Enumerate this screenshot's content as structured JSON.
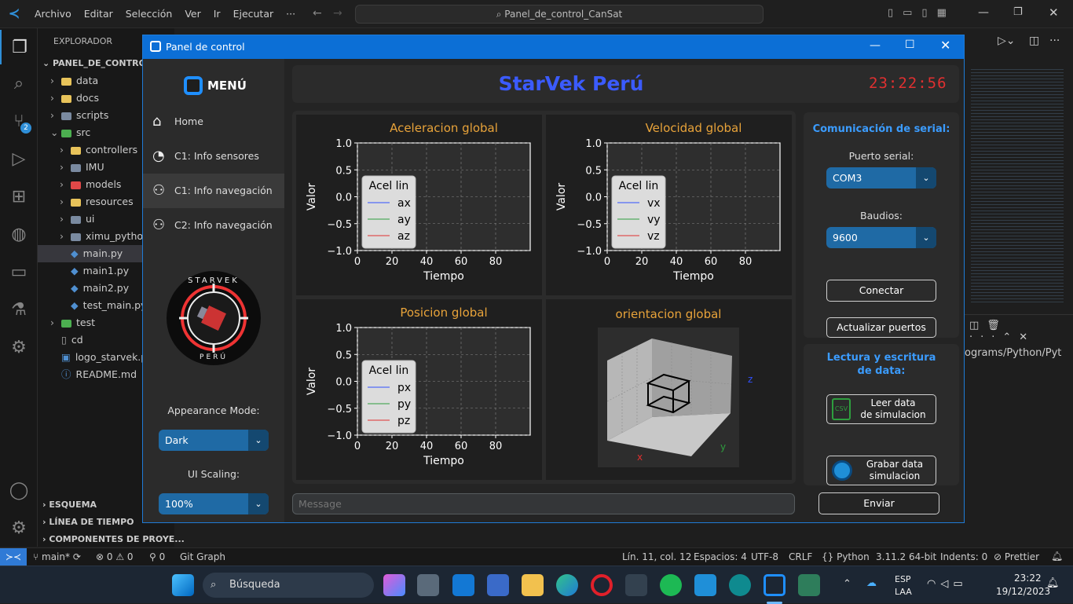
{
  "vscode": {
    "menu": [
      "Archivo",
      "Editar",
      "Selección",
      "Ver",
      "Ir",
      "Ejecutar",
      "···"
    ],
    "search_text": "Panel_de_control_CanSat",
    "explorer_title": "EXPLORADOR",
    "project_title": "PANEL_DE_CONTROL_...",
    "tree": [
      {
        "label": "data",
        "kind": "folder",
        "color": "#e8c35a",
        "indent": 1
      },
      {
        "label": "docs",
        "kind": "folder",
        "color": "#e8c35a",
        "indent": 1
      },
      {
        "label": "scripts",
        "kind": "folder",
        "color": "#7a8aa0",
        "indent": 1
      },
      {
        "label": "src",
        "kind": "folder-open",
        "color": "#4caf50",
        "indent": 1
      },
      {
        "label": "controllers",
        "kind": "folder",
        "color": "#e8c35a",
        "indent": 2
      },
      {
        "label": "IMU",
        "kind": "folder",
        "color": "#7a8aa0",
        "indent": 2
      },
      {
        "label": "models",
        "kind": "folder",
        "color": "#e04848",
        "indent": 2
      },
      {
        "label": "resources",
        "kind": "folder",
        "color": "#e8c35a",
        "indent": 2
      },
      {
        "label": "ui",
        "kind": "folder",
        "color": "#7a8aa0",
        "indent": 2
      },
      {
        "label": "ximu_python...",
        "kind": "folder",
        "color": "#7a8aa0",
        "indent": 2
      },
      {
        "label": "main.py",
        "kind": "py",
        "indent": 2
      },
      {
        "label": "main1.py",
        "kind": "py",
        "indent": 2
      },
      {
        "label": "main2.py",
        "kind": "py",
        "indent": 2
      },
      {
        "label": "test_main.py",
        "kind": "py",
        "indent": 2
      },
      {
        "label": "test",
        "kind": "folder",
        "color": "#4caf50",
        "indent": 1
      },
      {
        "label": "cd",
        "kind": "file",
        "indent": 1
      },
      {
        "label": "logo_starvek.png",
        "kind": "img",
        "indent": 1
      },
      {
        "label": "README.md",
        "kind": "info",
        "indent": 1
      }
    ],
    "bottom_sections": [
      "ESQUEMA",
      "LÍNEA DE TIEMPO",
      "COMPONENTES DE PROYE..."
    ],
    "terminal_path": "ograms/Python/Pyt",
    "scm_badge": "2",
    "status_left": [
      "main*",
      "⊗ 0 ⚠ 0",
      "⚲ 0",
      "Git Graph"
    ],
    "status_right": [
      "Lín. 11, col. 12",
      "Espacios: 4",
      "UTF-8",
      "CRLF",
      "{} Python",
      "3.11.2 64-bit",
      "Indents: 0",
      "⊘ Prettier"
    ]
  },
  "taskbar": {
    "search": "Búsqueda",
    "lang": "ESP",
    "lang2": "LAA",
    "time": "23:22",
    "date": "19/12/2023"
  },
  "app": {
    "title": "Panel de control",
    "menu_title": "MENÚ",
    "nav": [
      {
        "label": "Home",
        "icon": "home-icon"
      },
      {
        "label": "C1: Info sensores",
        "icon": "chat-icon"
      },
      {
        "label": "C1: Info navegación",
        "icon": "user-gear-icon"
      },
      {
        "label": "C2: Info navegación",
        "icon": "user-gear-icon"
      }
    ],
    "logo_top": "STARVEK",
    "logo_bottom": "PERÚ",
    "appearance_label": "Appearance Mode:",
    "appearance_value": "Dark",
    "scaling_label": "UI Scaling:",
    "scaling_value": "100%",
    "header_title": "StarVek Perú",
    "clock": "23:22:56",
    "serial_title": "Comunicación de serial:",
    "port_label": "Puerto serial:",
    "port_value": "COM3",
    "baud_label": "Baudios:",
    "baud_value": "9600",
    "connect_label": "Conectar",
    "refresh_label": "Actualizar puertos",
    "rw_title_1": "Lectura y escritura",
    "rw_title_2": "de data:",
    "read_label_1": "Leer data",
    "read_label_2": "de simulacion",
    "record_label_1": "Grabar data",
    "record_label_2": "simulacion",
    "message_placeholder": "Message",
    "send_label": "Enviar",
    "orient_title": "orientacion global",
    "orient_axes": [
      "x",
      "y",
      "z"
    ]
  },
  "colors": {
    "accent": "#1f6aa5",
    "title_blue": "#3b5bff",
    "clock_red": "#e03030",
    "plot_title": "#e8a33a",
    "serial_title": "#3b9cff"
  },
  "chart_data": [
    {
      "type": "line",
      "title": "Aceleracion global",
      "xlabel": "Tiempo",
      "ylabel": "Valor",
      "xlim": [
        0,
        100
      ],
      "ylim": [
        -1,
        1
      ],
      "xticks": [
        0,
        20,
        40,
        60,
        80
      ],
      "yticks": [
        1.0,
        0.5,
        0.0,
        -0.5,
        -1.0
      ],
      "grid": true,
      "legend_title": "Acel lin",
      "legend_position": "left",
      "series": [
        {
          "name": "ax",
          "color": "#3050ff",
          "x": [],
          "y": []
        },
        {
          "name": "ay",
          "color": "#2e9e3e",
          "x": [],
          "y": []
        },
        {
          "name": "az",
          "color": "#e03030",
          "x": [],
          "y": []
        }
      ]
    },
    {
      "type": "line",
      "title": "Velocidad global",
      "xlabel": "Tiempo",
      "ylabel": "Valor",
      "xlim": [
        0,
        100
      ],
      "ylim": [
        -1,
        1
      ],
      "xticks": [
        0,
        20,
        40,
        60,
        80
      ],
      "yticks": [
        1.0,
        0.5,
        0.0,
        -0.5,
        -1.0
      ],
      "grid": true,
      "legend_title": "Acel lin",
      "legend_position": "left",
      "series": [
        {
          "name": "vx",
          "color": "#3050ff",
          "x": [],
          "y": []
        },
        {
          "name": "vy",
          "color": "#2e9e3e",
          "x": [],
          "y": []
        },
        {
          "name": "vz",
          "color": "#e03030",
          "x": [],
          "y": []
        }
      ]
    },
    {
      "type": "line",
      "title": "Posicion global",
      "xlabel": "Tiempo",
      "ylabel": "Valor",
      "xlim": [
        0,
        100
      ],
      "ylim": [
        -1,
        1
      ],
      "xticks": [
        0,
        20,
        40,
        60,
        80
      ],
      "yticks": [
        1.0,
        0.5,
        0.0,
        -0.5,
        -1.0
      ],
      "grid": true,
      "legend_title": "Acel lin",
      "legend_position": "left",
      "series": [
        {
          "name": "px",
          "color": "#3050ff",
          "x": [],
          "y": []
        },
        {
          "name": "py",
          "color": "#2e9e3e",
          "x": [],
          "y": []
        },
        {
          "name": "pz",
          "color": "#e03030",
          "x": [],
          "y": []
        }
      ]
    }
  ]
}
